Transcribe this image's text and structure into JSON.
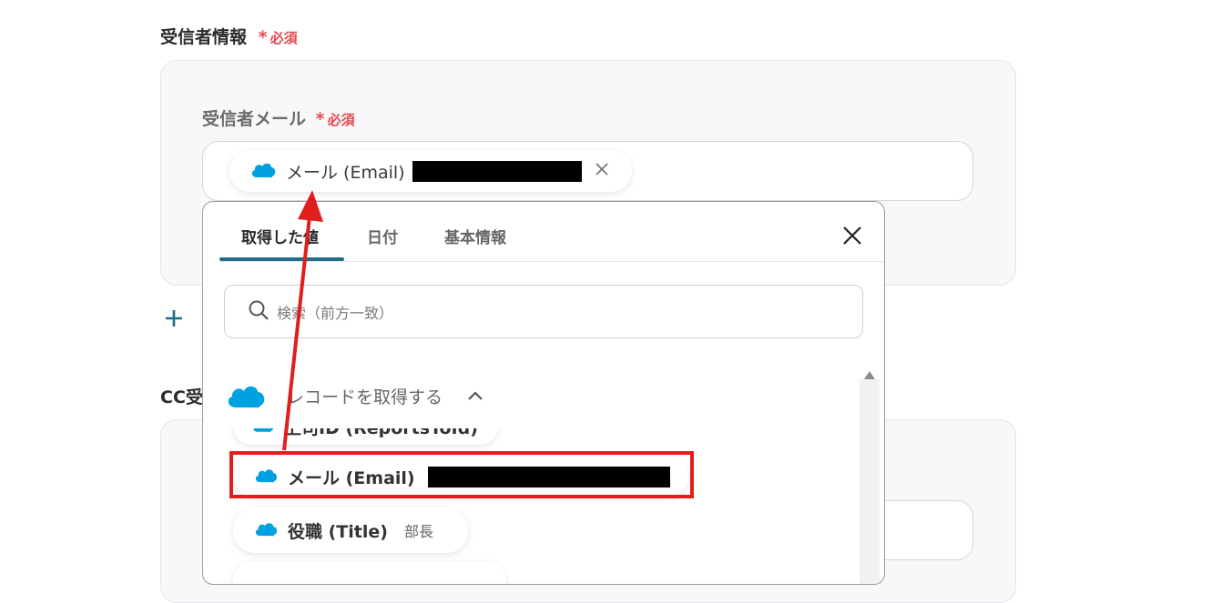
{
  "recipient_section": {
    "title": "受信者情報",
    "required_star": "*",
    "required_label": "必須"
  },
  "recipient_email": {
    "label": "受信者メール",
    "required_star": "*",
    "required_label": "必須",
    "chip_label": "メール (Email)"
  },
  "add_button": {
    "symbol": "+"
  },
  "cc_section": {
    "title_partial": "CC受"
  },
  "picker": {
    "tabs": [
      {
        "label": "取得した値"
      },
      {
        "label": "日付"
      },
      {
        "label": "基本情報"
      }
    ],
    "close_symbol": "×",
    "search_placeholder": "検索（前方一致）",
    "group": {
      "title": "レコードを取得する"
    },
    "items": [
      {
        "label": "上司ID (ReportsToId)"
      },
      {
        "label": "メール (Email)"
      },
      {
        "label": "役職 (Title)",
        "value": "部長"
      }
    ]
  },
  "colors": {
    "required": "#e5484d",
    "accent_tab": "#1f6f8b",
    "annotation": "#e01e1e",
    "salesforce": "#00a1e0"
  }
}
